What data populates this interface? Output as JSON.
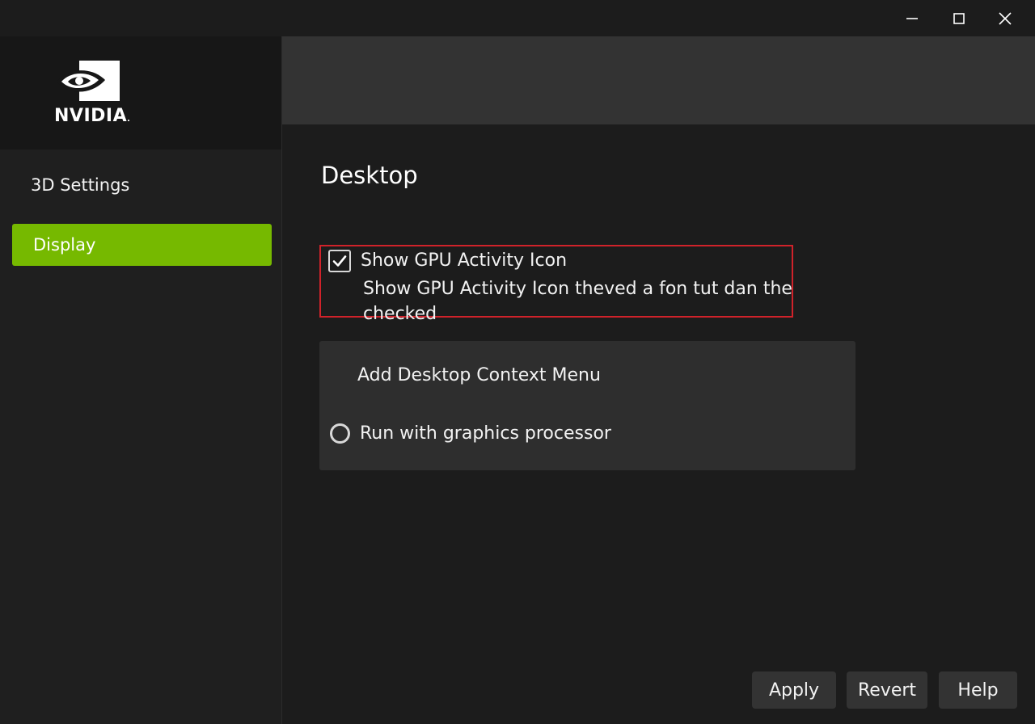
{
  "brand": {
    "logo_text": "NVIDIA",
    "accent_color": "#76b900",
    "highlight_color": "#d0222a"
  },
  "window_controls": {
    "minimize_icon": "minimize-icon",
    "maximize_icon": "maximize-icon",
    "close_icon": "close-icon"
  },
  "sidebar": {
    "items": [
      {
        "label": "3D Settings",
        "selected": false
      },
      {
        "label": "Display",
        "selected": true
      }
    ]
  },
  "main": {
    "title": "Desktop",
    "gpu_activity": {
      "label": "Show GPU Activity Icon",
      "checked": true,
      "description": "Show GPU Activity Icon theved a fon tut dan the checked"
    },
    "context_menu": {
      "heading": "Add Desktop Context Menu",
      "radio_label": "Run with graphics processor",
      "radio_selected": false
    }
  },
  "footer": {
    "apply_label": "Apply",
    "revert_label": "Revert",
    "help_label": "Help"
  }
}
